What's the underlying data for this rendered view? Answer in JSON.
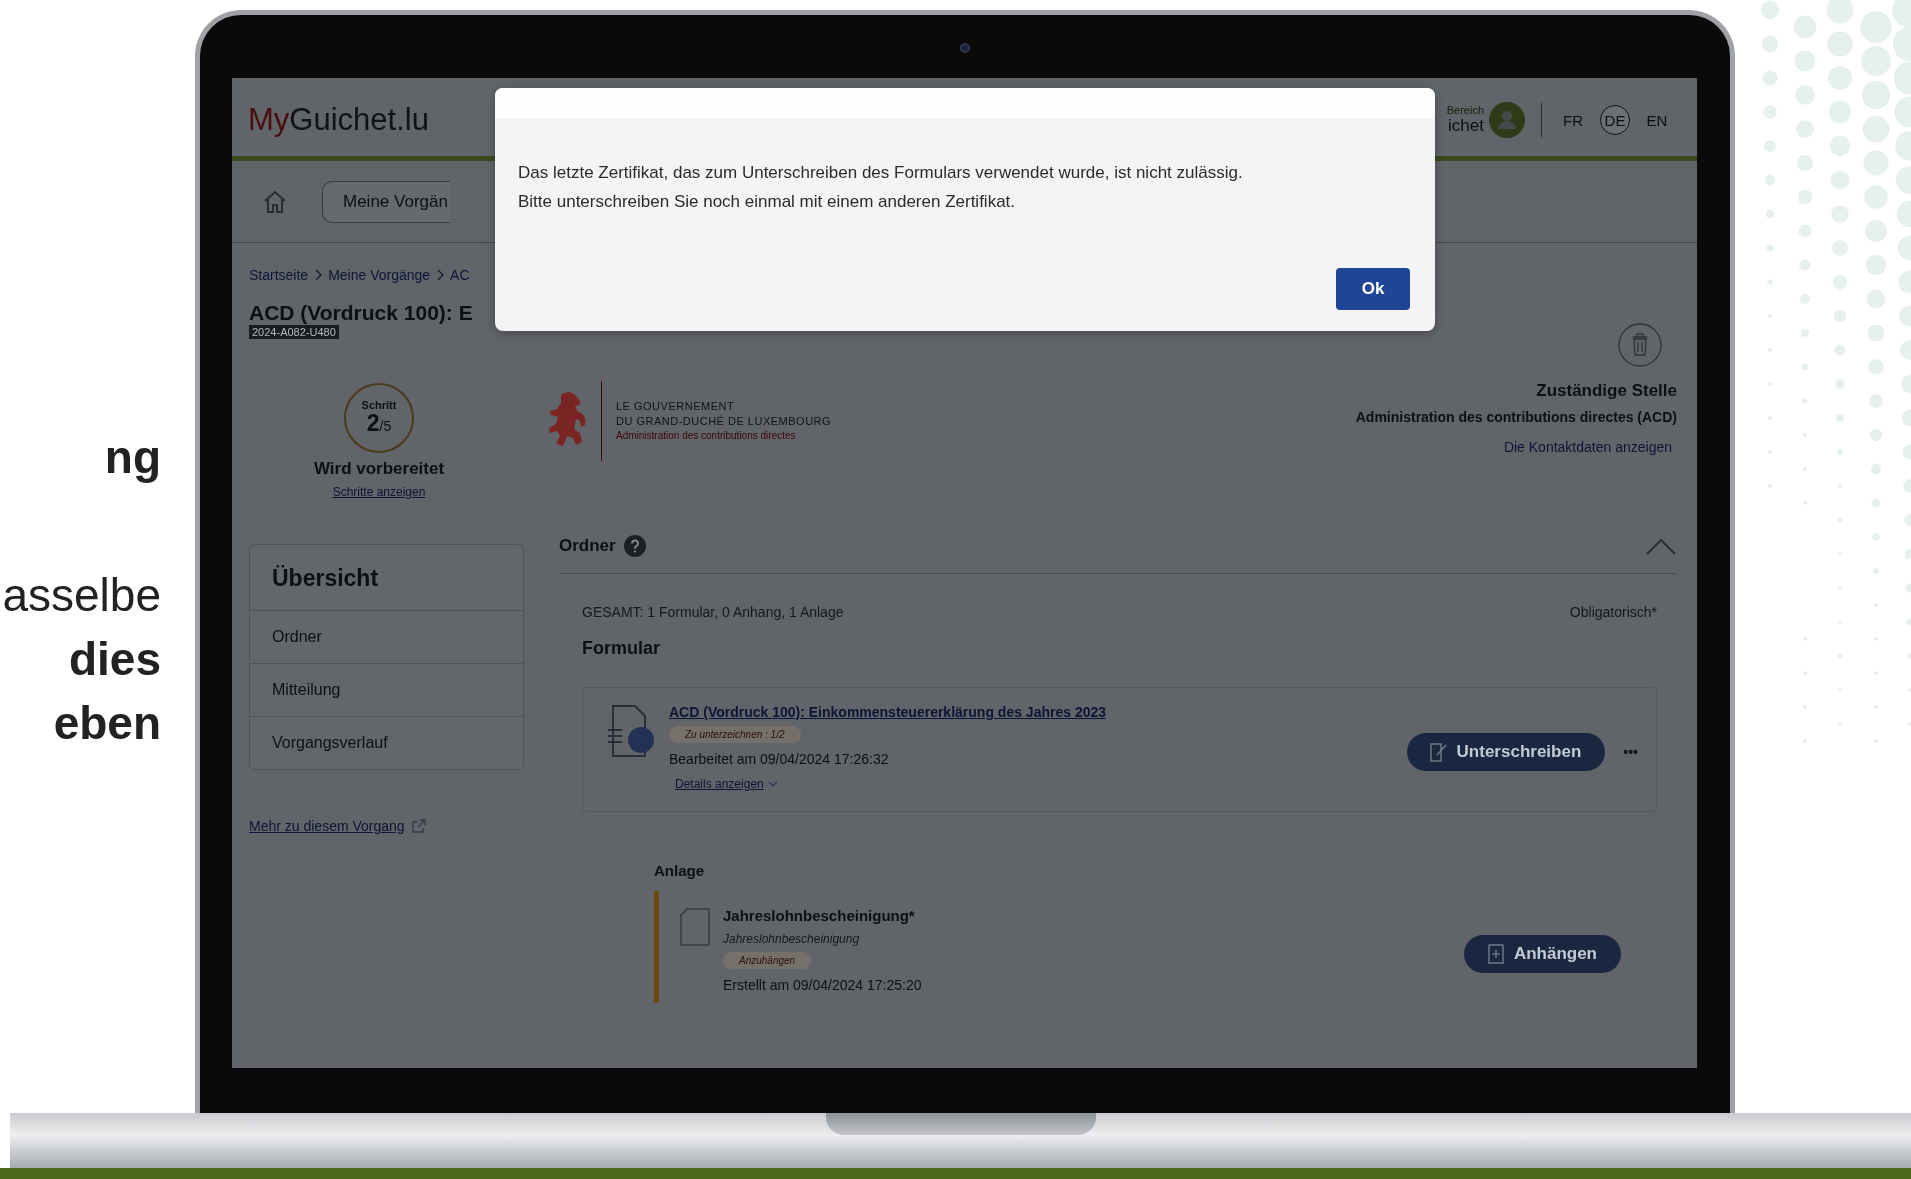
{
  "slide_text": [
    {
      "text": "ng",
      "kind": "heading"
    },
    {
      "text": "asselbe",
      "kind": "body"
    },
    {
      "text": "dies",
      "kind": "body_bold"
    },
    {
      "text": "eben",
      "kind": "body_bold"
    }
  ],
  "header": {
    "logo_prefix": "My",
    "logo_rest": "Guichet.lu",
    "account_label": "Bereich",
    "account_name": "ichet",
    "languages": [
      {
        "label": "FR",
        "selected": false
      },
      {
        "label": "DE",
        "selected": true
      },
      {
        "label": "EN",
        "selected": false
      }
    ]
  },
  "nav": {
    "button": "Meine Vorgän"
  },
  "breadcrumb": [
    "Startseite",
    "Meine Vorgänge",
    "AC"
  ],
  "title": "ACD (Vordruck 100): E",
  "reference": "2024-A082-U480",
  "step": {
    "label": "Schritt",
    "current": "2",
    "total": "/5",
    "status": "Wird vorbereitet",
    "link": "Schritte anzeigen"
  },
  "authority_logo": {
    "line1": "LE GOUVERNEMENT",
    "line2": "DU GRAND-DUCHÉ DE LUXEMBOURG",
    "line3": "Administration des contributions directes"
  },
  "competent_office": {
    "heading": "Zuständige Stelle",
    "name": "Administration des contributions directes (ACD)",
    "link": "Die Kontaktdaten anzeigen"
  },
  "sidebar": {
    "title": "Übersicht",
    "items": [
      "Ordner",
      "Mitteilung",
      "Vorgangsverlauf"
    ]
  },
  "more_link": "Mehr zu diesem Vorgang",
  "folder": {
    "title": "Ordner",
    "expanded": true,
    "summary": "GESAMT: 1 Formular, 0 Anhang, 1 Anlage",
    "required_note": "Obligatorisch*",
    "form_heading": "Formular",
    "form": {
      "title": "ACD (Vordruck 100): Einkommensteuererklärung des Jahres 2023",
      "status": "Zu unterzeichnen : 1/2",
      "edited": "Bearbeitet am 09/04/2024 17:26:32",
      "details": "Details anzeigen",
      "action": "Unterschreiben",
      "more": "•••"
    },
    "attachment_heading": "Anlage",
    "attachment": {
      "title": "Jahreslohnbescheinigung*",
      "subtitle": "Jahreslohnbescheinigung",
      "status": "Anzuhängen",
      "created": "Erstellt am 09/04/2024 17:25:20",
      "action": "Anhängen"
    }
  },
  "dialog": {
    "lines": [
      "Das letzte Zertifikat, das zum Unterschreiben des Formulars verwendet wurde, ist nicht zulässig.",
      "Bitte unterschreiben Sie noch einmal mit einem anderen Zertifikat."
    ],
    "button": "Ok"
  }
}
